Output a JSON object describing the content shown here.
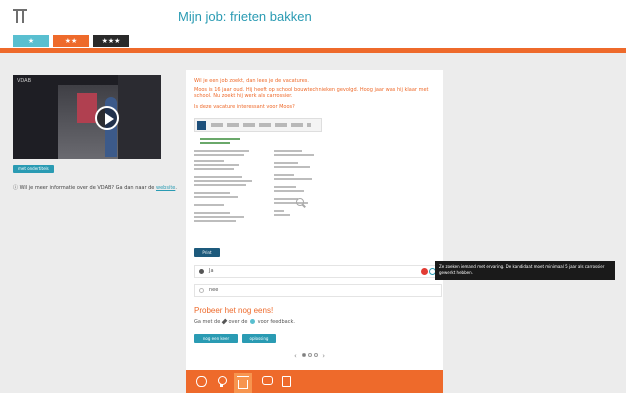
{
  "header": {
    "title": "Mijn job: frieten bakken",
    "levels": [
      "★",
      "★★",
      "★★★"
    ]
  },
  "video": {
    "brand": "VDAB",
    "subtitles_label": "met ondertitels"
  },
  "info": {
    "text": "Wil je meer informatie over de VDAB? Ga dan naar de",
    "link": "website",
    "suffix": "."
  },
  "question": {
    "line1": "Wil je een job zoekt, dan lees je de vacatures.",
    "line2": "Moos is 16 jaar oud. Hij heeft op school bouwtechnieken gevolgd. Hoog jaar was hij klaar met school. Nu zoekt hij werk als carrossier.",
    "line3": "Is deze vacature interessant voor Moos?"
  },
  "print_label": "Print",
  "answers": [
    {
      "label": "Ja",
      "selected": true
    },
    {
      "label": "nee",
      "selected": false
    }
  ],
  "feedback": {
    "retry": "Probeer het nog eens!",
    "prefix": "Ga met de",
    "middle": "over de",
    "suffix": "voor feedback."
  },
  "actions": {
    "again": "nog een keer",
    "solution": "oplossing"
  },
  "pager": {
    "prev": "‹",
    "next": "›",
    "pages": 3,
    "current": 1
  },
  "tooltip": "Ze zoeken iemand met ervaring. De kandidaat moet minimaal 5 jaar als carrossier gewerkt hebben.",
  "colors": {
    "accent": "#ee6a2b",
    "teal": "#2a9bb3",
    "dark": "#2a2a2a"
  }
}
